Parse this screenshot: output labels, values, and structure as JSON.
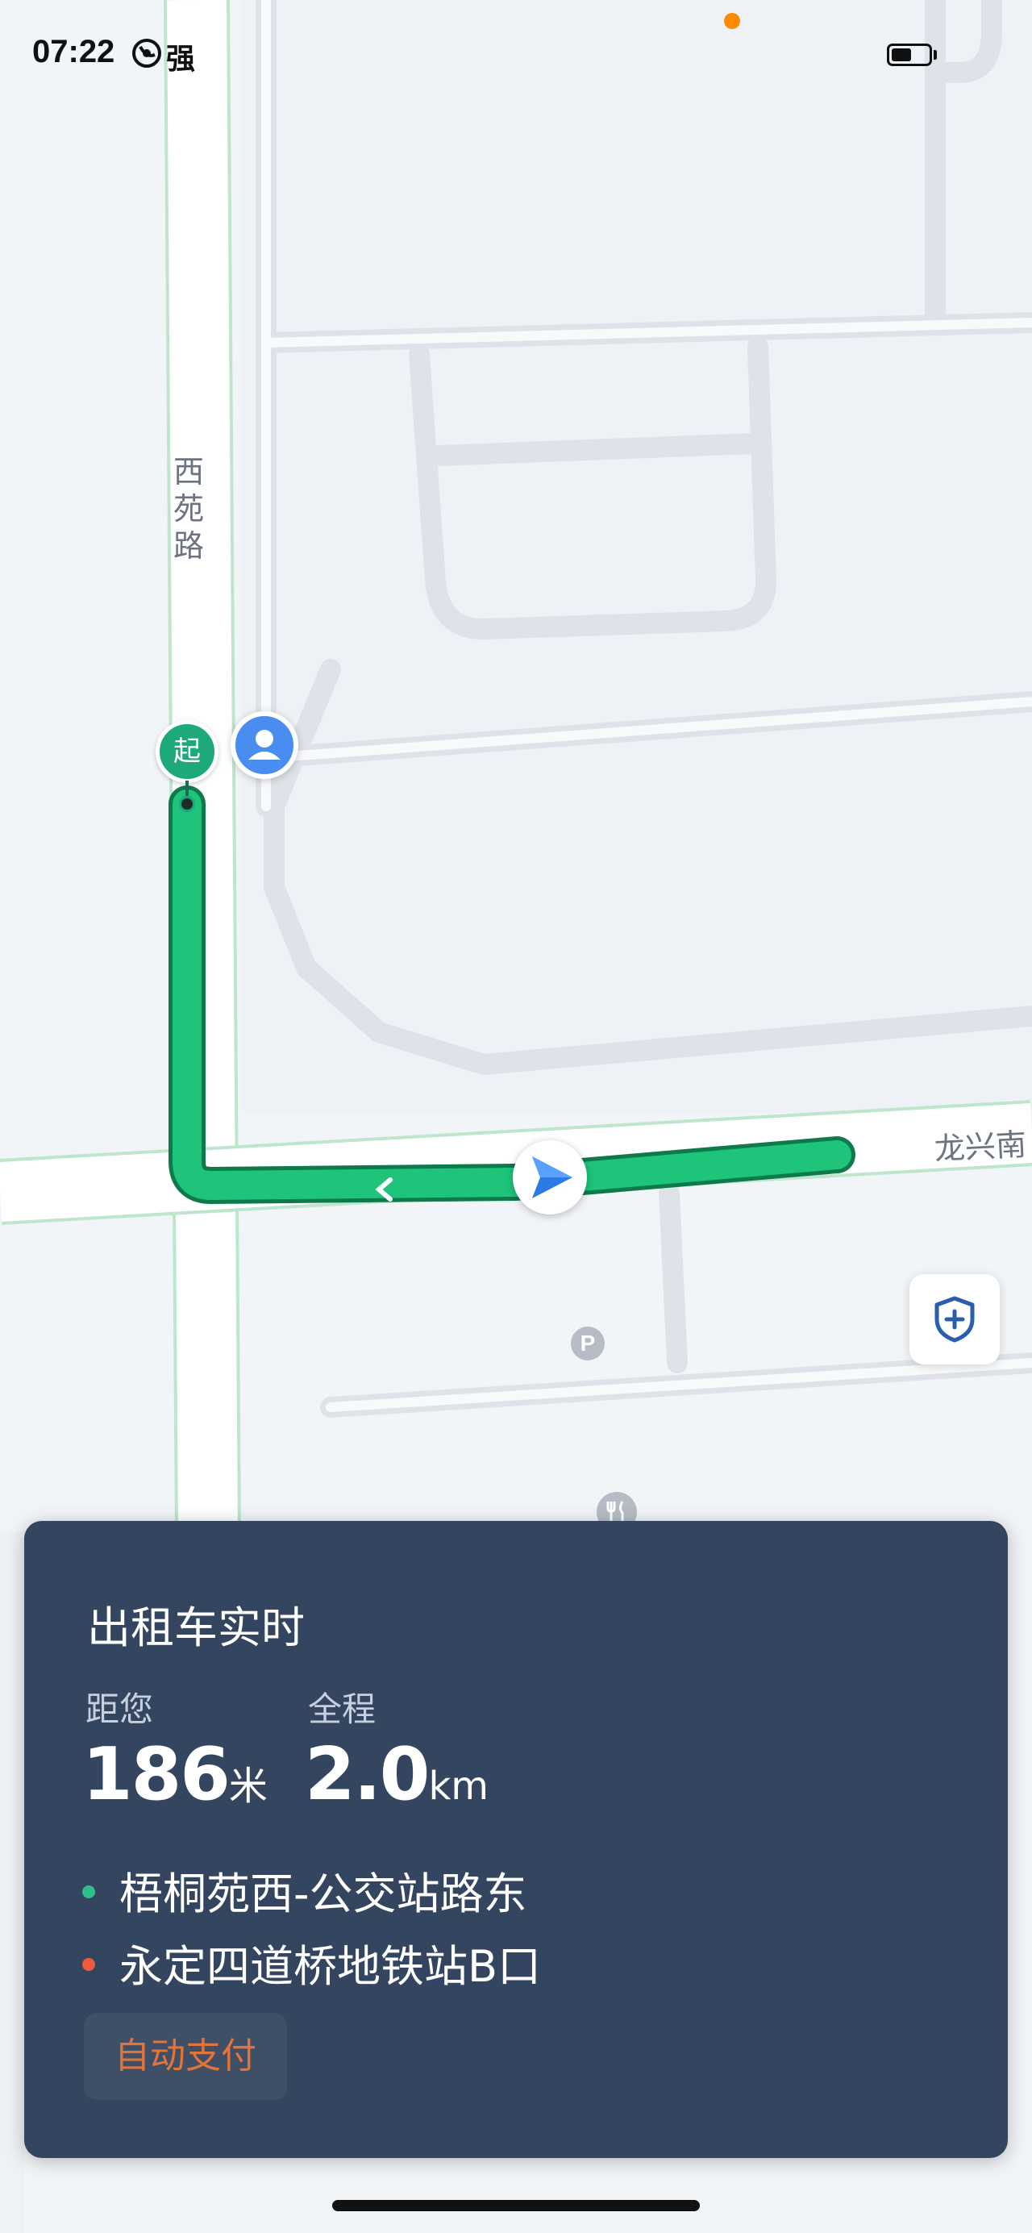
{
  "status_bar": {
    "time": "07:22",
    "signal_text": "强",
    "battery_percent": 55
  },
  "map": {
    "road_name_vertical": [
      "西",
      "苑",
      "路"
    ],
    "road_name_horizontal": "龙兴南",
    "start_marker_label": "起",
    "route_color": "#1ec47a",
    "icons": [
      "user-avatar-icon",
      "car-arrow-icon",
      "parking-icon",
      "restaurant-icon",
      "safety-shield-icon"
    ]
  },
  "card": {
    "title": "出租车实时",
    "distance": {
      "label": "距您",
      "value": "186",
      "unit": "米"
    },
    "total": {
      "label": "全程",
      "value": "2.0",
      "unit": "km"
    },
    "origin": {
      "text": "梧桐苑西-公交站路东",
      "dot_color": "#2ec08a"
    },
    "destination": {
      "text": "永定四道桥地铁站B口",
      "dot_color": "#f05a3c"
    },
    "autopay_label": "自动支付"
  }
}
